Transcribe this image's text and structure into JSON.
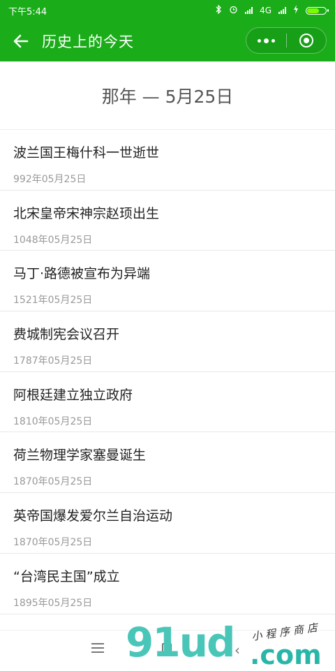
{
  "status_bar": {
    "time": "下午5:44",
    "network": "4G"
  },
  "nav": {
    "title": "历史上的今天"
  },
  "date_header": "那年 — 5月25日",
  "events": [
    {
      "title": "波兰国王梅什科一世逝世",
      "date": "992年05月25日"
    },
    {
      "title": "北宋皇帝宋神宗赵顼出生",
      "date": "1048年05月25日"
    },
    {
      "title": "马丁·路德被宣布为异端",
      "date": "1521年05月25日"
    },
    {
      "title": "费城制宪会议召开",
      "date": "1787年05月25日"
    },
    {
      "title": "阿根廷建立独立政府",
      "date": "1810年05月25日"
    },
    {
      "title": "荷兰物理学家塞曼诞生",
      "date": "1870年05月25日"
    },
    {
      "title": "英帝国爆发爱尔兰自治运动",
      "date": "1870年05月25日"
    },
    {
      "title": "“台湾民主国”成立",
      "date": "1895年05月25日"
    }
  ],
  "watermark": {
    "logo": "91ud",
    "domain": ".com",
    "tagline": "小程序商店"
  },
  "colors": {
    "brand_green": "#1aad19",
    "watermark_teal": "#49c6b8"
  }
}
